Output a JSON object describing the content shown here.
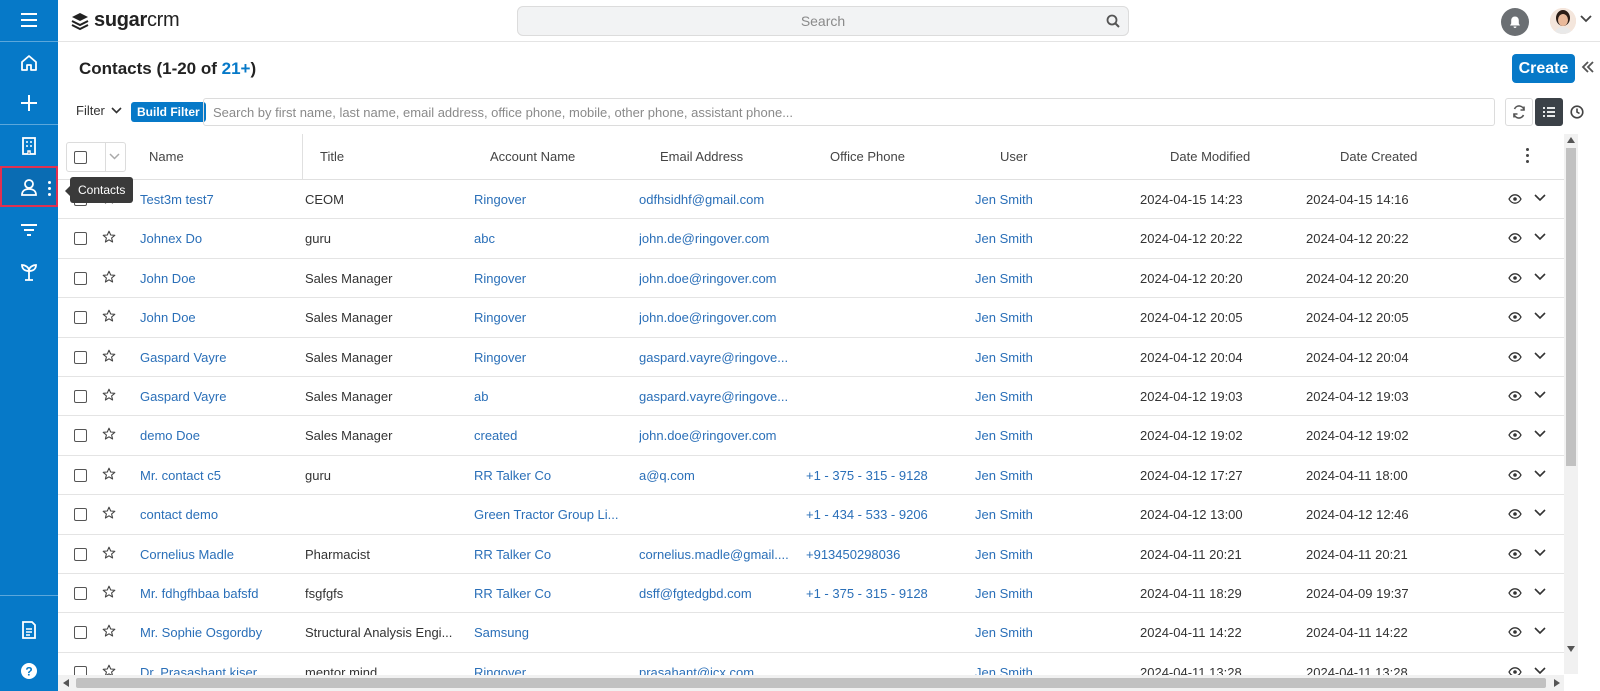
{
  "app": {
    "logo_prefix": "sugar",
    "logo_suffix": "crm"
  },
  "search": {
    "placeholder": "Search"
  },
  "sidebar": {
    "items": [
      {
        "name": "menu",
        "icon": "hamburger-icon"
      },
      {
        "name": "home",
        "icon": "home-icon"
      },
      {
        "name": "quick-create",
        "icon": "plus-icon"
      },
      {
        "name": "accounts",
        "icon": "building-icon"
      },
      {
        "name": "contacts",
        "icon": "contact-icon",
        "active": true
      },
      {
        "name": "leads",
        "icon": "funnel-icon"
      },
      {
        "name": "opportunities",
        "icon": "sprout-icon"
      },
      {
        "name": "reports",
        "icon": "document-icon"
      },
      {
        "name": "help",
        "icon": "help-icon"
      }
    ],
    "tooltip": "Contacts"
  },
  "header": {
    "title_prefix": "Contacts (1-20 of ",
    "count": "21+",
    "title_suffix": ")",
    "create_label": "Create"
  },
  "filter": {
    "label": "Filter",
    "build_label": "Build Filter",
    "search_placeholder": "Search by first name, last name, email address, office phone, mobile, other phone, assistant phone..."
  },
  "table": {
    "columns": [
      "Name",
      "Title",
      "Account Name",
      "Email Address",
      "Office Phone",
      "User",
      "Date Modified",
      "Date Created"
    ],
    "rows": [
      [
        "Test3m test7",
        "CEOM",
        "Ringover",
        "odfhsidhf@gmail.com",
        "",
        "Jen Smith",
        "2024-04-15 14:23",
        "2024-04-15 14:16"
      ],
      [
        "Johnex Do",
        "guru",
        "abc",
        "john.de@ringover.com",
        "",
        "Jen Smith",
        "2024-04-12 20:22",
        "2024-04-12 20:22"
      ],
      [
        "John Doe",
        "Sales Manager",
        "Ringover",
        "john.doe@ringover.com",
        "",
        "Jen Smith",
        "2024-04-12 20:20",
        "2024-04-12 20:20"
      ],
      [
        "John Doe",
        "Sales Manager",
        "Ringover",
        "john.doe@ringover.com",
        "",
        "Jen Smith",
        "2024-04-12 20:05",
        "2024-04-12 20:05"
      ],
      [
        "Gaspard Vayre",
        "Sales Manager",
        "Ringover",
        "gaspard.vayre@ringove...",
        "",
        "Jen Smith",
        "2024-04-12 20:04",
        "2024-04-12 20:04"
      ],
      [
        "Gaspard Vayre",
        "Sales Manager",
        "ab",
        "gaspard.vayre@ringove...",
        "",
        "Jen Smith",
        "2024-04-12 19:03",
        "2024-04-12 19:03"
      ],
      [
        "demo Doe",
        "Sales Manager",
        "created",
        "john.doe@ringover.com",
        "",
        "Jen Smith",
        "2024-04-12 19:02",
        "2024-04-12 19:02"
      ],
      [
        "Mr. contact c5",
        "guru",
        "RR Talker Co",
        "a@q.com",
        "+1 - 375 - 315 - 9128",
        "Jen Smith",
        "2024-04-12 17:27",
        "2024-04-11 18:00"
      ],
      [
        "contact demo",
        "",
        "Green Tractor Group Li...",
        "",
        "+1 - 434 - 533 - 9206",
        "Jen Smith",
        "2024-04-12 13:00",
        "2024-04-12 12:46"
      ],
      [
        "Cornelius Madle",
        "Pharmacist",
        "RR Talker Co",
        "cornelius.madle@gmail....",
        "+913450298036",
        "Jen Smith",
        "2024-04-11 20:21",
        "2024-04-11 20:21"
      ],
      [
        "Mr. fdhgfhbaa bafsfd",
        "fsgfgfs",
        "RR Talker Co",
        "dsff@fgtedgbd.com",
        "+1 - 375 - 315 - 9128",
        "Jen Smith",
        "2024-04-11 18:29",
        "2024-04-09 19:37"
      ],
      [
        "Mr. Sophie Osgordby",
        "Structural Analysis Engi...",
        "Samsung",
        "",
        "",
        "Jen Smith",
        "2024-04-11 14:22",
        "2024-04-11 14:22"
      ],
      [
        "Dr. Prasashant kiser",
        "mentor mind",
        "Ringover",
        "prasahant@icx.com",
        "",
        "Jen Smith",
        "2024-04-11 13:28",
        "2024-04-11 13:28"
      ]
    ]
  }
}
